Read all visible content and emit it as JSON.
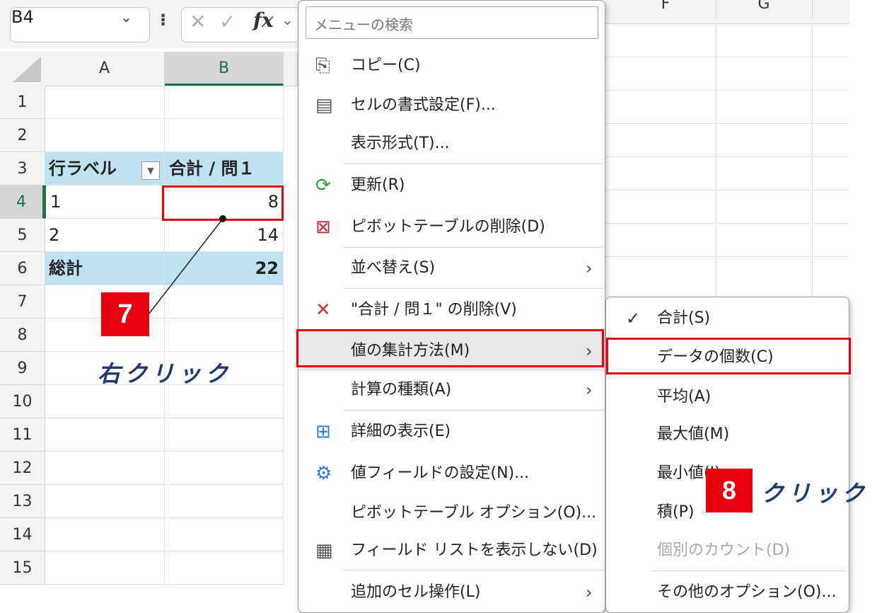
{
  "formula_bar": {
    "name_box": "B4",
    "fx": "fx"
  },
  "columns": [
    "A",
    "B",
    "F",
    "G"
  ],
  "rows": [
    "1",
    "2",
    "3",
    "4",
    "5",
    "6",
    "7",
    "8",
    "9",
    "10",
    "11",
    "12",
    "13",
    "14",
    "15"
  ],
  "pivot": {
    "header_row_label": "行ラベル",
    "header_value": "合計 / 問１",
    "rows": [
      {
        "label": "1",
        "value": "8"
      },
      {
        "label": "2",
        "value": "14"
      }
    ],
    "total_label": "総計",
    "total_value": "22"
  },
  "context_menu": {
    "search_placeholder": "メニューの検索",
    "items": [
      {
        "label": "コピー(C)",
        "icon": "copy-icon"
      },
      {
        "label": "セルの書式設定(F)...",
        "icon": "format-cells-icon"
      },
      {
        "label": "表示形式(T)...",
        "icon": ""
      },
      {
        "label": "更新(R)",
        "icon": "refresh-icon"
      },
      {
        "label": "ピボットテーブルの削除(D)",
        "icon": "delete-pivot-icon"
      },
      {
        "label": "並べ替え(S)",
        "icon": "",
        "submenu": true
      },
      {
        "label": "\"合計 / 問１\" の削除(V)",
        "icon": "remove-icon"
      },
      {
        "label": "値の集計方法(M)",
        "icon": "",
        "submenu": true
      },
      {
        "label": "計算の種類(A)",
        "icon": "",
        "submenu": true
      },
      {
        "label": "詳細の表示(E)",
        "icon": "show-details-icon"
      },
      {
        "label": "値フィールドの設定(N)...",
        "icon": "field-settings-icon"
      },
      {
        "label": "ピボットテーブル オプション(O)...",
        "icon": ""
      },
      {
        "label": "フィールド リストを表示しない(D)",
        "icon": "field-list-icon"
      },
      {
        "label": "追加のセル操作(L)",
        "icon": "",
        "submenu": true
      }
    ]
  },
  "submenu": {
    "items": [
      {
        "label": "合計(S)",
        "checked": true,
        "disabled": false
      },
      {
        "label": "データの個数(C)",
        "checked": false,
        "disabled": false
      },
      {
        "label": "平均(A)",
        "checked": false,
        "disabled": false
      },
      {
        "label": "最大値(M)",
        "checked": false,
        "disabled": false
      },
      {
        "label": "最小値(I)",
        "checked": false,
        "disabled": false
      },
      {
        "label": "積(P)",
        "checked": false,
        "disabled": false
      },
      {
        "label": "個別のカウント(D)",
        "checked": false,
        "disabled": true
      },
      {
        "label": "その他のオプション(O)...",
        "checked": false,
        "disabled": false
      }
    ]
  },
  "annotations": {
    "step7_number": "7",
    "step7_text": "右クリック",
    "step8_number": "8",
    "step8_text": "クリック"
  },
  "colors": {
    "highlight_red": "#e8000f",
    "pivot_blue": "#bfe2f2",
    "note_navy": "#1f3a6e"
  }
}
